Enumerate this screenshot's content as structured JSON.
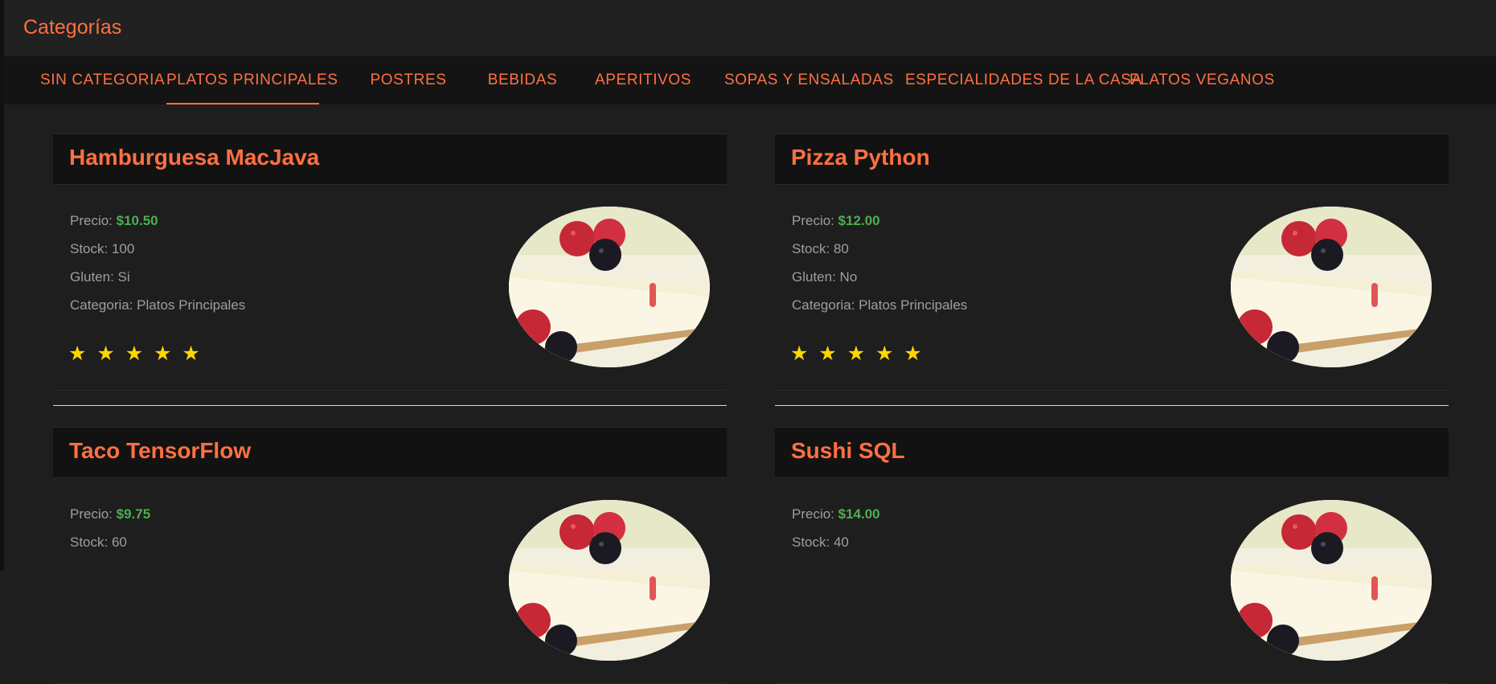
{
  "header": {
    "title": "Categorías"
  },
  "tabs": [
    {
      "label": "SIN CATEGORIA"
    },
    {
      "label": "PLATOS PRINCIPALES",
      "active": true
    },
    {
      "label": "POSTRES"
    },
    {
      "label": "BEBIDAS"
    },
    {
      "label": "APERITIVOS"
    },
    {
      "label": "SOPAS Y ENSALADAS"
    },
    {
      "label": "ESPECIALIDADES DE LA CASA"
    },
    {
      "label": "PLATOS VEGANOS"
    }
  ],
  "labels": {
    "price": "Precio: ",
    "stock": "Stock: ",
    "gluten": "Gluten: ",
    "category": "Categoria: "
  },
  "products": [
    {
      "name": "Hamburguesa MacJava",
      "price": "$10.50",
      "stock": "100",
      "gluten": "Si",
      "category": "Platos Principales",
      "stars": "★ ★ ★ ★ ★",
      "rating": 5
    },
    {
      "name": "Pizza Python",
      "price": "$12.00",
      "stock": "80",
      "gluten": "No",
      "category": "Platos Principales",
      "stars": "★ ★ ★ ★ ★",
      "rating": 5
    },
    {
      "name": "Taco TensorFlow",
      "price": "$9.75",
      "stock": "60"
    },
    {
      "name": "Sushi SQL",
      "price": "$14.00",
      "stock": "40"
    }
  ],
  "colors": {
    "accent": "#ff7043",
    "price": "#4caf50",
    "star": "#ffd600",
    "background": "#1e1e1e"
  },
  "icons": {
    "dish_image": "cheesecake-with-berries"
  }
}
